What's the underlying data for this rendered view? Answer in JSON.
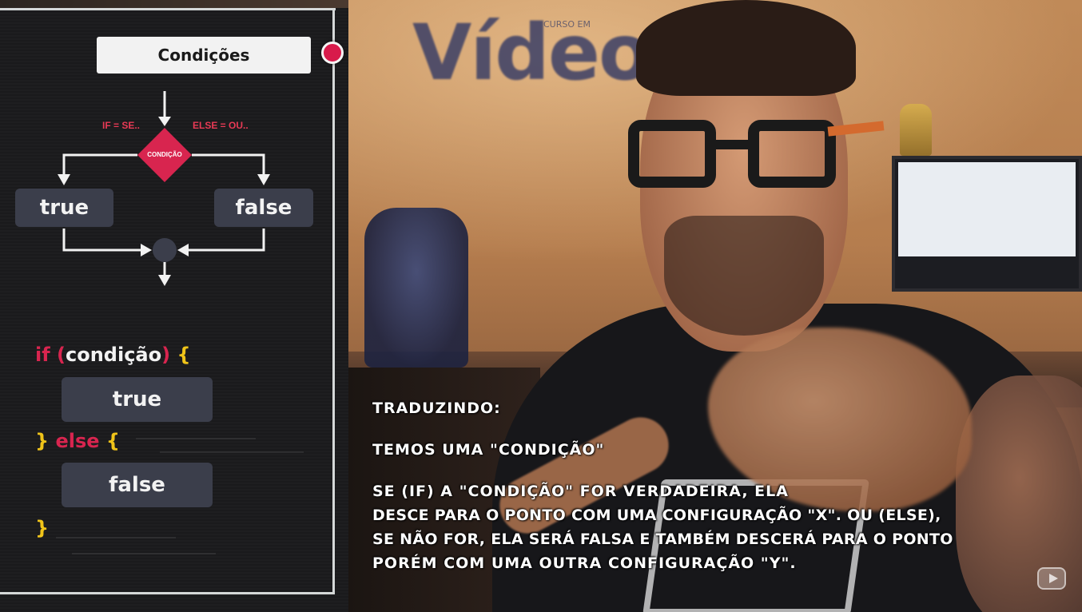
{
  "diagram": {
    "title": "Condições",
    "if_label": "IF = SE..",
    "else_label": "ELSE = OU..",
    "decision_label": "CONDIÇÃO",
    "true_box": "true",
    "false_box": "false"
  },
  "code": {
    "if_kw": "if",
    "open_paren": "(",
    "condition": "condição",
    "close_paren": ")",
    "open_brace": "{",
    "true_block": "true",
    "close_brace": "}",
    "else_kw": "else",
    "else_open_brace": "{",
    "false_block": "false",
    "final_brace": "}"
  },
  "video": {
    "brand_text": "Vídeo",
    "brand_small": "CURSO EM"
  },
  "subtitles": {
    "line1": "TRADUZINDO:",
    "line2": "TEMOS UMA \"CONDIÇÃO\"",
    "line3": "SE (IF) A \"CONDIÇÃO\" FOR VERDADEIRA, ELA",
    "line4": "DESCE PARA O PONTO COM UMA  CONFIGURAÇÃO \"X\". OU (ELSE),",
    "line5": "SE NÃO FOR, ELA SERÁ FALSA E TAMBÉM DESCERÁ PARA O PONTO",
    "line6": "PORÉM COM UMA OUTRA CONFIGURAÇÃO \"Y\"."
  },
  "colors": {
    "accent_red": "#d8254f",
    "brace_yellow": "#f0c419",
    "box_gray": "#3b3e4b"
  },
  "icons": [
    "record-dot-icon",
    "youtube-badge-icon"
  ]
}
